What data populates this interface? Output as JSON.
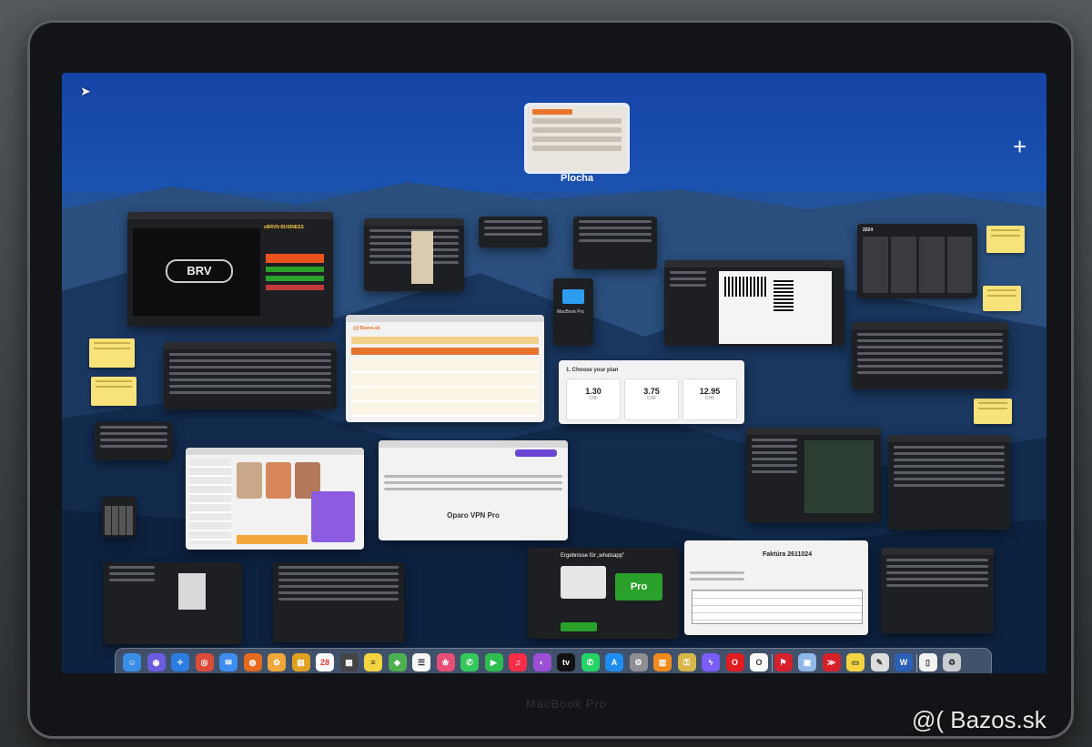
{
  "desktop": {
    "space_label": "Plocha",
    "add_space": "+",
    "cursor_glyph": "➤"
  },
  "windows": {
    "business_name": "eBRVN BUSINESS",
    "brv_logo": "BRV",
    "bazos_header": "@( Bazos.sk",
    "macbook_pro_label": "MacBook Pro",
    "calendar_year": "2024",
    "plan_title": "1. Choose your plan",
    "prices": [
      {
        "value": "1.30",
        "currency": "CHF"
      },
      {
        "value": "3.75",
        "currency": "CHF"
      },
      {
        "value": "12.95",
        "currency": "CHF"
      }
    ],
    "vpn_title": "Oparo VPN Pro",
    "search_results_title": "Ergebnisse für „whatsapp\"",
    "pro_badge": "Pro",
    "invoice_title": "Faktúra 2611024"
  },
  "dock": {
    "items": [
      {
        "name": "finder-icon",
        "color": "#3a8ee6",
        "glyph": "☺"
      },
      {
        "name": "siri-icon",
        "color": "#6b5be0",
        "glyph": "◉"
      },
      {
        "name": "safari-icon",
        "color": "#2b7de0",
        "glyph": "✧"
      },
      {
        "name": "chrome-icon",
        "color": "#dd4b39",
        "glyph": "◎"
      },
      {
        "name": "mail-icon",
        "color": "#3d8ef0",
        "glyph": "✉"
      },
      {
        "name": "firefox-icon",
        "color": "#e66a1e",
        "glyph": "◍"
      },
      {
        "name": "photos-icon",
        "color": "#f0a83a",
        "glyph": "✿"
      },
      {
        "name": "notes-folder-icon",
        "color": "#e0a020",
        "glyph": "▤"
      },
      {
        "name": "calendar-icon",
        "color": "#ffffff",
        "glyph": "28"
      },
      {
        "name": "calculator-icon",
        "color": "#444444",
        "glyph": "▦"
      },
      {
        "name": "notes-icon",
        "color": "#f5d442",
        "glyph": "≡"
      },
      {
        "name": "maps-icon",
        "color": "#4caf50",
        "glyph": "◆"
      },
      {
        "name": "reminders-icon",
        "color": "#f7f7f7",
        "glyph": "☰"
      },
      {
        "name": "photos-app-icon",
        "color": "#e94e77",
        "glyph": "❀"
      },
      {
        "name": "messages-icon",
        "color": "#34c759",
        "glyph": "✆"
      },
      {
        "name": "facetime-icon",
        "color": "#2ebd4f",
        "glyph": "▶"
      },
      {
        "name": "music-icon",
        "color": "#fa2d48",
        "glyph": "♫"
      },
      {
        "name": "podcasts-icon",
        "color": "#9b4fd6",
        "glyph": "◐"
      },
      {
        "name": "tv-icon",
        "color": "#111111",
        "glyph": "tv"
      },
      {
        "name": "whatsapp-icon",
        "color": "#25d366",
        "glyph": "✆"
      },
      {
        "name": "app-store-icon",
        "color": "#1e8cf0",
        "glyph": "A"
      },
      {
        "name": "system-settings-icon",
        "color": "#8e8e93",
        "glyph": "⚙"
      },
      {
        "name": "books-icon",
        "color": "#f28b1e",
        "glyph": "▥"
      },
      {
        "name": "keychain-icon",
        "color": "#d7b64a",
        "glyph": "⚿"
      },
      {
        "name": "messenger-icon",
        "color": "#7a5cff",
        "glyph": "ϟ"
      },
      {
        "name": "opera-icon",
        "color": "#e11b22",
        "glyph": "O"
      },
      {
        "name": "opera-gx-icon",
        "color": "#ffffff",
        "glyph": "O"
      },
      {
        "name": "acrobat-icon",
        "color": "#d8202a",
        "glyph": "⚑"
      },
      {
        "name": "preview-icon",
        "color": "#8fb7e8",
        "glyph": "▣"
      },
      {
        "name": "parallels-icon",
        "color": "#d8202a",
        "glyph": "≫"
      },
      {
        "name": "stickies-icon",
        "color": "#f5d442",
        "glyph": "▭"
      },
      {
        "name": "script-editor-icon",
        "color": "#dddddd",
        "glyph": "✎"
      },
      {
        "name": "word-icon",
        "color": "#2b5fb8",
        "glyph": "W"
      },
      {
        "name": "document-icon",
        "color": "#f2f2f2",
        "glyph": "▯"
      },
      {
        "name": "trash-icon",
        "color": "#c9ccd1",
        "glyph": "♻"
      }
    ],
    "calendar_day": "28"
  },
  "device": {
    "model_label": "MacBook Pro"
  },
  "watermark": "@( Bazos.sk",
  "colors": {
    "accent_blue": "#1b52b0",
    "sticky_yellow": "#f8e27a",
    "whatsapp_green": "#2aa12a"
  }
}
